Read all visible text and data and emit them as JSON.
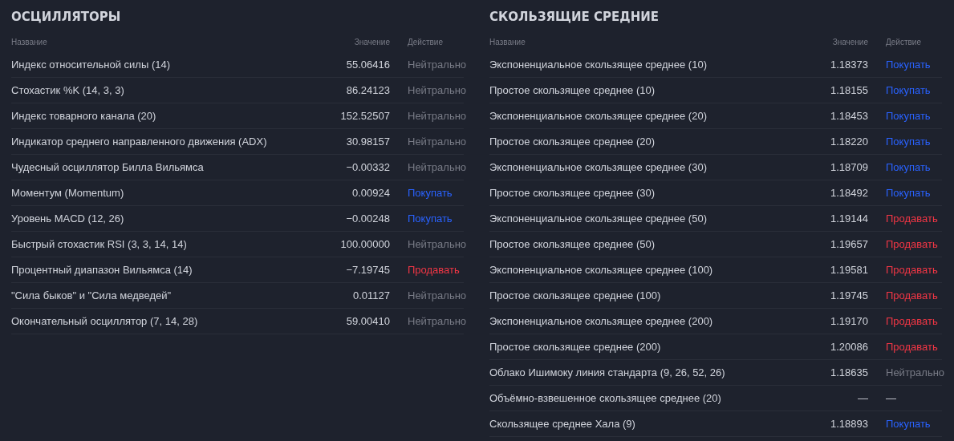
{
  "panels": [
    {
      "title": "ОСЦИЛЛЯТОРЫ",
      "columns": [
        "Название",
        "Значение",
        "Действие"
      ],
      "rows": [
        {
          "name": "Индекс относительной силы (14)",
          "value": "55.06416",
          "action": {
            "kind": "neutral",
            "label": "Нейтрально"
          }
        },
        {
          "name": "Стохастик %K (14, 3, 3)",
          "value": "86.24123",
          "action": {
            "kind": "neutral",
            "label": "Нейтрально"
          }
        },
        {
          "name": "Индекс товарного канала (20)",
          "value": "152.52507",
          "action": {
            "kind": "neutral",
            "label": "Нейтрально"
          }
        },
        {
          "name": "Индикатор среднего направленного движения (ADX)",
          "value": "30.98157",
          "action": {
            "kind": "neutral",
            "label": "Нейтрально"
          }
        },
        {
          "name": "Чудесный осциллятор Билла Вильямса",
          "value": "−0.00332",
          "action": {
            "kind": "neutral",
            "label": "Нейтрально"
          }
        },
        {
          "name": "Моментум (Momentum)",
          "value": "0.00924",
          "action": {
            "kind": "buy",
            "label": "Покупать"
          }
        },
        {
          "name": "Уровень MACD (12, 26)",
          "value": "−0.00248",
          "action": {
            "kind": "buy",
            "label": "Покупать"
          }
        },
        {
          "name": "Быстрый стохастик RSI (3, 3, 14, 14)",
          "value": "100.00000",
          "action": {
            "kind": "neutral",
            "label": "Нейтрально"
          }
        },
        {
          "name": "Процентный диапазон Вильямса (14)",
          "value": "−7.19745",
          "action": {
            "kind": "sell",
            "label": "Продавать"
          }
        },
        {
          "name": "\"Сила быков\" и \"Сила медведей\"",
          "value": "0.01127",
          "action": {
            "kind": "neutral",
            "label": "Нейтрально"
          }
        },
        {
          "name": "Окончательный осциллятор (7, 14, 28)",
          "value": "59.00410",
          "action": {
            "kind": "neutral",
            "label": "Нейтрально"
          }
        }
      ]
    },
    {
      "title": "СКОЛЬЗЯЩИЕ СРЕДНИЕ",
      "columns": [
        "Название",
        "Значение",
        "Действие"
      ],
      "rows": [
        {
          "name": "Экспоненциальное скользящее среднее (10)",
          "value": "1.18373",
          "action": {
            "kind": "buy",
            "label": "Покупать"
          }
        },
        {
          "name": "Простое скользящее среднее (10)",
          "value": "1.18155",
          "action": {
            "kind": "buy",
            "label": "Покупать"
          }
        },
        {
          "name": "Экспоненциальное скользящее среднее (20)",
          "value": "1.18453",
          "action": {
            "kind": "buy",
            "label": "Покупать"
          }
        },
        {
          "name": "Простое скользящее среднее (20)",
          "value": "1.18220",
          "action": {
            "kind": "buy",
            "label": "Покупать"
          }
        },
        {
          "name": "Экспоненциальное скользящее среднее (30)",
          "value": "1.18709",
          "action": {
            "kind": "buy",
            "label": "Покупать"
          }
        },
        {
          "name": "Простое скользящее среднее (30)",
          "value": "1.18492",
          "action": {
            "kind": "buy",
            "label": "Покупать"
          }
        },
        {
          "name": "Экспоненциальное скользящее среднее (50)",
          "value": "1.19144",
          "action": {
            "kind": "sell",
            "label": "Продавать"
          }
        },
        {
          "name": "Простое скользящее среднее (50)",
          "value": "1.19657",
          "action": {
            "kind": "sell",
            "label": "Продавать"
          }
        },
        {
          "name": "Экспоненциальное скользящее среднее (100)",
          "value": "1.19581",
          "action": {
            "kind": "sell",
            "label": "Продавать"
          }
        },
        {
          "name": "Простое скользящее среднее (100)",
          "value": "1.19745",
          "action": {
            "kind": "sell",
            "label": "Продавать"
          }
        },
        {
          "name": "Экспоненциальное скользящее среднее (200)",
          "value": "1.19170",
          "action": {
            "kind": "sell",
            "label": "Продавать"
          }
        },
        {
          "name": "Простое скользящее среднее (200)",
          "value": "1.20086",
          "action": {
            "kind": "sell",
            "label": "Продавать"
          }
        },
        {
          "name": "Облако Ишимоку линия стандарта (9, 26, 52, 26)",
          "value": "1.18635",
          "action": {
            "kind": "neutral",
            "label": "Нейтрально"
          }
        },
        {
          "name": "Объёмно-взвешенное скользящее среднее (20)",
          "value": "—",
          "action": {
            "kind": "none",
            "label": "—"
          }
        },
        {
          "name": "Скользящее среднее Хала (9)",
          "value": "1.18893",
          "action": {
            "kind": "buy",
            "label": "Покупать"
          }
        }
      ]
    }
  ]
}
